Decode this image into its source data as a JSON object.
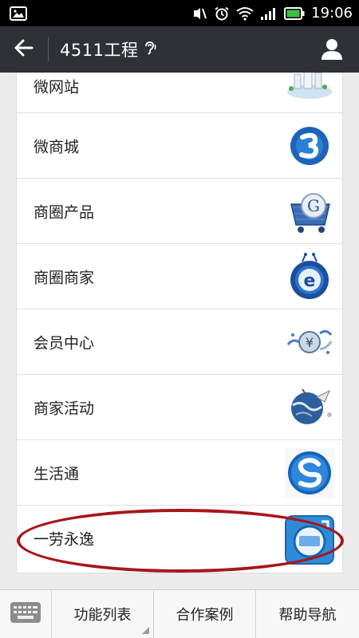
{
  "status_bar": {
    "time": "19:06",
    "icons": [
      "image-notification-icon",
      "mute-icon",
      "alarm-icon",
      "wifi-icon",
      "signal-icon",
      "battery-icon"
    ]
  },
  "header": {
    "title": "4511工程",
    "back_icon": "back-arrow-icon",
    "ear_icon": "ear-icon",
    "profile_icon": "profile-icon"
  },
  "list": {
    "items": [
      {
        "label": "微网站",
        "icon": "site-icon"
      },
      {
        "label": "微商城",
        "icon": "mall-icon"
      },
      {
        "label": "商圈产品",
        "icon": "product-icon"
      },
      {
        "label": "商圈商家",
        "icon": "merchant-icon"
      },
      {
        "label": "会员中心",
        "icon": "member-icon"
      },
      {
        "label": "商家活动",
        "icon": "activity-icon"
      },
      {
        "label": "生活通",
        "icon": "life-icon"
      },
      {
        "label": "一劳永逸",
        "icon": "app-icon"
      }
    ]
  },
  "bottom_menu": {
    "keyboard_icon": "keyboard-icon",
    "items": [
      "功能列表",
      "合作案例",
      "帮助导航"
    ]
  },
  "colors": {
    "status_bar": "#000000",
    "title_bar": "#2e3236",
    "highlight": "#a8151b",
    "battery": "#3fbf3f"
  }
}
